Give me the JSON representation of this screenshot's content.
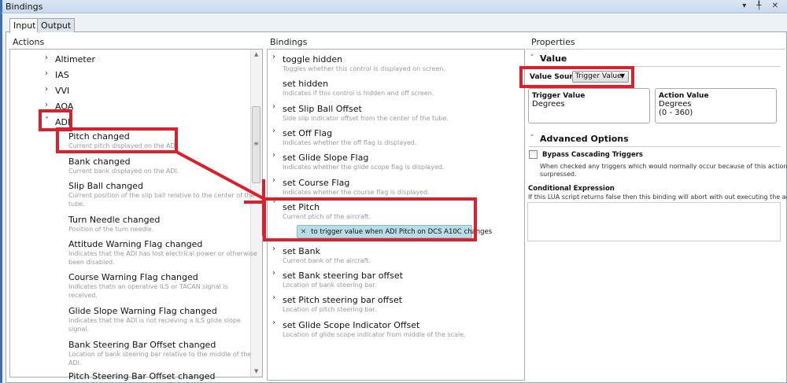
{
  "window": {
    "title": "Bindings",
    "controls": "▾ ╀ ✕"
  },
  "tabs": [
    {
      "label": "Input",
      "active": true
    },
    {
      "label": "Output",
      "active": false
    }
  ],
  "actions": {
    "header": "Actions",
    "tree": [
      {
        "label": "Altimeter",
        "expanded": false
      },
      {
        "label": "IAS",
        "expanded": false
      },
      {
        "label": "VVI",
        "expanded": false
      },
      {
        "label": "AOA",
        "expanded": false
      },
      {
        "label": "ADI",
        "expanded": true
      }
    ],
    "children": [
      {
        "label": "Pitch changed",
        "desc": [
          "Current pitch displayed on the ADI."
        ]
      },
      {
        "label": "Bank changed",
        "desc": [
          "Current bank displayed on the ADI."
        ]
      },
      {
        "label": "Slip Ball changed",
        "desc": [
          "Current position of the slip ball relative to the center of the",
          "tube."
        ]
      },
      {
        "label": "Turn Needle changed",
        "desc": [
          "Position of the turn needle."
        ]
      },
      {
        "label": "Attitude Warning Flag changed",
        "desc": [
          "Indicates that the ADI has lost electrical power or otherwise",
          "been disabled."
        ]
      },
      {
        "label": "Course Warning Flag changed",
        "desc": [
          "Indicates thatn an operative ILS or TACAN signal is",
          "received."
        ]
      },
      {
        "label": "Glide Slope Warning Flag changed",
        "desc": [
          "Indicates that the ADI is not recieving a ILS glide slope",
          "signal."
        ]
      },
      {
        "label": "Bank Steering Bar Offset changed",
        "desc": [
          "Location of bank steering bar relative to the middle of the",
          "ADI."
        ]
      },
      {
        "label": "Pitch Steering Bar Offset changed",
        "desc": []
      }
    ]
  },
  "bindings": {
    "header": "Bindings",
    "items": [
      {
        "label": "toggle hidden",
        "desc": "Toggles whether this control is displayed on screen.",
        "chevron": ">"
      },
      {
        "label": "set hidden",
        "desc": "Indicates if this control is hidden and off screen.",
        "chevron": ""
      },
      {
        "label": "set Slip Ball Offset",
        "desc": "Side slip indicator offset from the center of the tube.",
        "chevron": ">"
      },
      {
        "label": "set Off Flag",
        "desc": "Indicates whether the off flag is displayed.",
        "chevron": ">"
      },
      {
        "label": "set Glide Slope Flag",
        "desc": "Indicates whether the glide scope flag is displayed.",
        "chevron": ">"
      },
      {
        "label": "set Course Flag",
        "desc": "Indicates whether the course flag is displayed.",
        "chevron": ">"
      },
      {
        "label": "set Pitch",
        "desc": "Current ptich of the aircraft.",
        "chevron": "˅"
      },
      {
        "label": "set Bank",
        "desc": "Current bank of the aircraft.",
        "chevron": ">"
      },
      {
        "label": "set Bank steering bar offset",
        "desc": "Location of bank steering bar.",
        "chevron": ">"
      },
      {
        "label": "set Pitch steering bar offset",
        "desc": "Location of pitch steering bar.",
        "chevron": ">"
      },
      {
        "label": "set Glide Scope Indicator Offset",
        "desc": "Location of glide scope indicator from middle of the scale.",
        "chevron": ">"
      }
    ],
    "binding_tag": "to trigger value when ADI Pitch on DCS A10C changes"
  },
  "properties": {
    "header": "Properties",
    "value_section": "Value",
    "value_source_label": "Value Source",
    "value_source": "Trigger Value",
    "trigger_value": {
      "title": "Trigger Value",
      "unit": "Degrees"
    },
    "action_value": {
      "title": "Action Value",
      "unit": "Degrees",
      "range": "(0 - 360)"
    },
    "advanced_section": "Advanced Options",
    "bypass_label": "Bypass Cascading Triggers",
    "bypass_checked": false,
    "bypass_desc": [
      "When checked any triggers which would normally occur because of this action are",
      "surpressed."
    ],
    "cond_label": "Conditional Expression",
    "cond_desc": "If this LUA script returns false then this binding will abort with out executing the action.",
    "cond_value": ""
  },
  "annotation_color": "#d9202c"
}
